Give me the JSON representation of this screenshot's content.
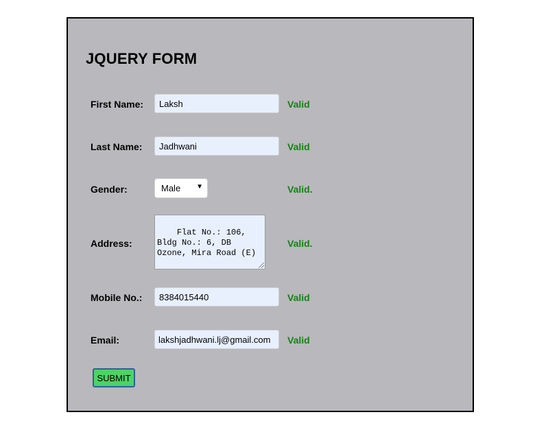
{
  "form": {
    "title": "JQUERY FORM",
    "first_name": {
      "label": "First Name:",
      "value": "Laksh",
      "status": "Valid"
    },
    "last_name": {
      "label": "Last Name:",
      "value": "Jadhwani",
      "status": "Valid"
    },
    "gender": {
      "label": "Gender:",
      "value": "Male",
      "status": "Valid."
    },
    "address": {
      "label": "Address:",
      "value": "Flat No.: 106, Bldg No.: 6, DB Ozone, Mira Road (E)",
      "status": "Valid."
    },
    "mobile": {
      "label": "Mobile No.:",
      "value": "8384015440",
      "status": "Valid"
    },
    "email": {
      "label": "Email:",
      "value": "lakshjadhwani.lj@gmail.com",
      "status": "Valid"
    },
    "submit_label": "SUBMIT"
  },
  "colors": {
    "panel_bg": "#b9b8bc",
    "valid_text": "#118511",
    "submit_bg": "#4cd366",
    "input_bg": "#e8f0fe"
  }
}
